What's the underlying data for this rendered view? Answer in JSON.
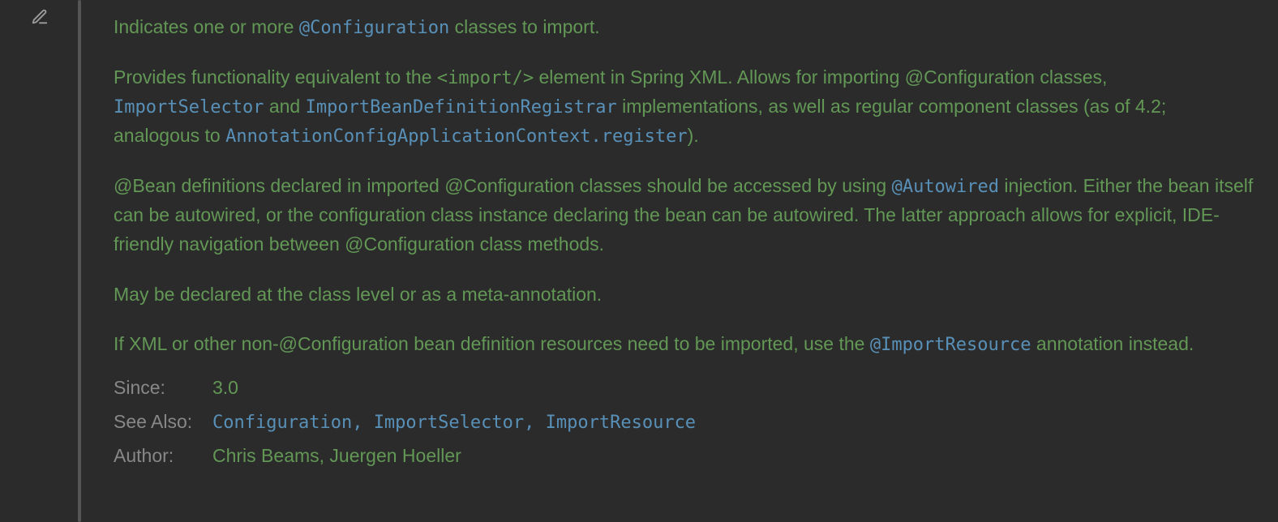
{
  "doc": {
    "p1": {
      "t1": "Indicates one or more ",
      "l1": "@Configuration",
      "t2": " classes to import."
    },
    "p2": {
      "t1": "Provides functionality equivalent to the ",
      "code1": "<import/>",
      "t2": " element in Spring XML. Allows for importing @Configuration classes, ",
      "l1": "ImportSelector",
      "t3": " and ",
      "l2": "ImportBeanDefinitionRegistrar",
      "t4": " implementations, as well as regular component classes (as of 4.2; analogous to ",
      "l3": "AnnotationConfigApplicationContext.register",
      "t5": ")."
    },
    "p3": {
      "t1": "@Bean definitions declared in imported @Configuration classes should be accessed by using ",
      "l1": "@Autowired",
      "t2": " injection. Either the bean itself can be autowired, or the configuration class instance declaring the bean can be autowired. The latter approach allows for explicit, IDE-friendly navigation between @Configuration class methods."
    },
    "p4": {
      "t1": "May be declared at the class level or as a meta-annotation."
    },
    "p5": {
      "t1": "If XML or other non-@Configuration bean definition resources need to be imported, use the ",
      "l1": "@ImportResource",
      "t2": " annotation instead."
    }
  },
  "meta": {
    "since_label": "Since:",
    "since_value": "3.0",
    "seealso_label": "See Also:",
    "seealso": {
      "l1": "Configuration",
      "l2": "ImportSelector",
      "l3": "ImportResource",
      "sep": ", "
    },
    "author_label": "Author:",
    "author_value": "Chris Beams, Juergen Hoeller"
  }
}
